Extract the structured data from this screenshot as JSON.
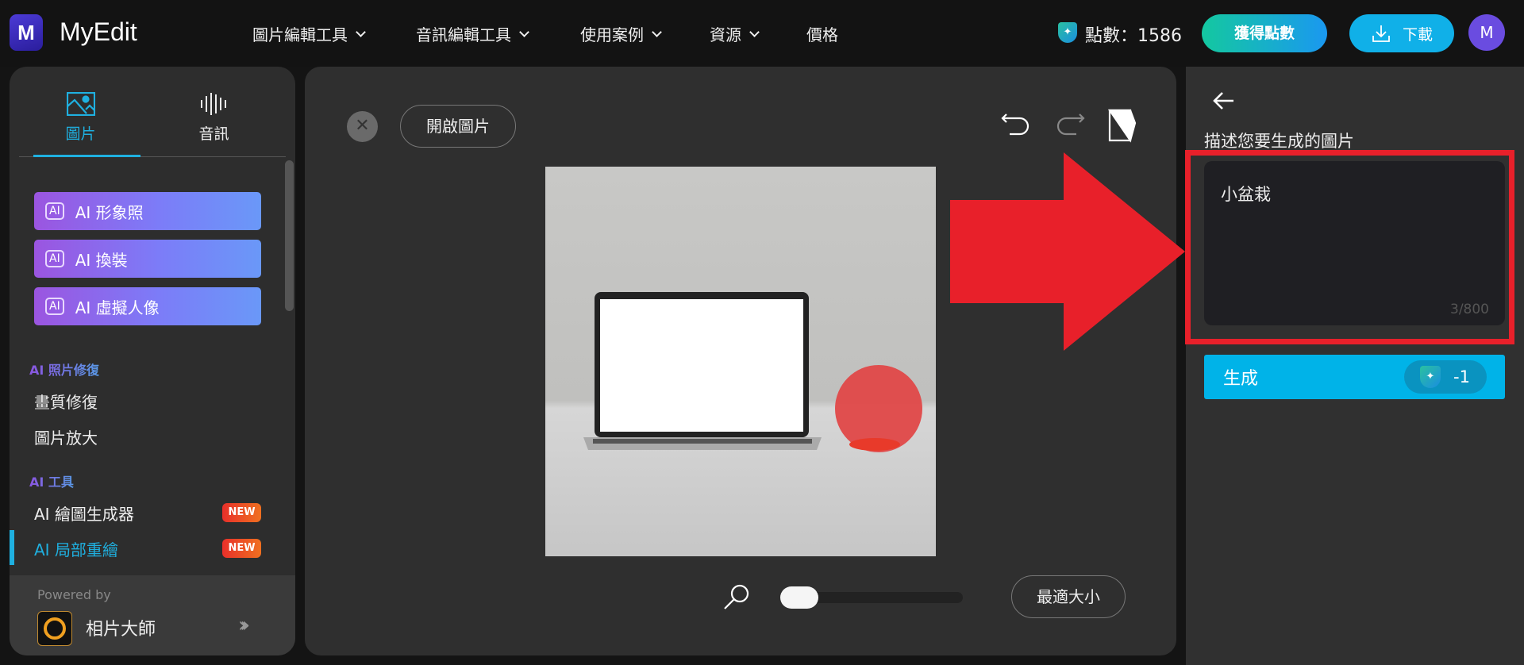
{
  "header": {
    "logo_letter": "M",
    "brand": "MyEdit",
    "nav": [
      "圖片編輯工具",
      "音訊編輯工具",
      "使用案例",
      "資源",
      "價格"
    ],
    "points_label": "點數：1586",
    "get_points": "獲得點數",
    "download": "下載",
    "avatar": "M"
  },
  "sidebar": {
    "tabs": [
      {
        "label": "圖片"
      },
      {
        "label": "音訊"
      }
    ],
    "ai_buttons": [
      "AI 形象照",
      "AI 換裝",
      "AI 虛擬人像"
    ],
    "sections": [
      {
        "title": "AI 照片修復",
        "items": [
          "畫質修復",
          "圖片放大"
        ]
      },
      {
        "title": "AI 工具",
        "items": [
          "AI 繪圖生成器",
          "AI 局部重繪"
        ]
      }
    ],
    "badge_new": "NEW",
    "powered_by": "Powered by",
    "partner": "相片大師"
  },
  "canvas": {
    "open_image": "開啟圖片",
    "fit": "最適大小",
    "zoom_fraction": 0.0
  },
  "panel": {
    "prompt_label": "描述您要生成的圖片",
    "prompt_value": "小盆栽",
    "counter": "3/800",
    "generate": "生成",
    "cost": "-1"
  },
  "colors": {
    "accent": "#00b3e8",
    "annotation": "#e8202a"
  }
}
